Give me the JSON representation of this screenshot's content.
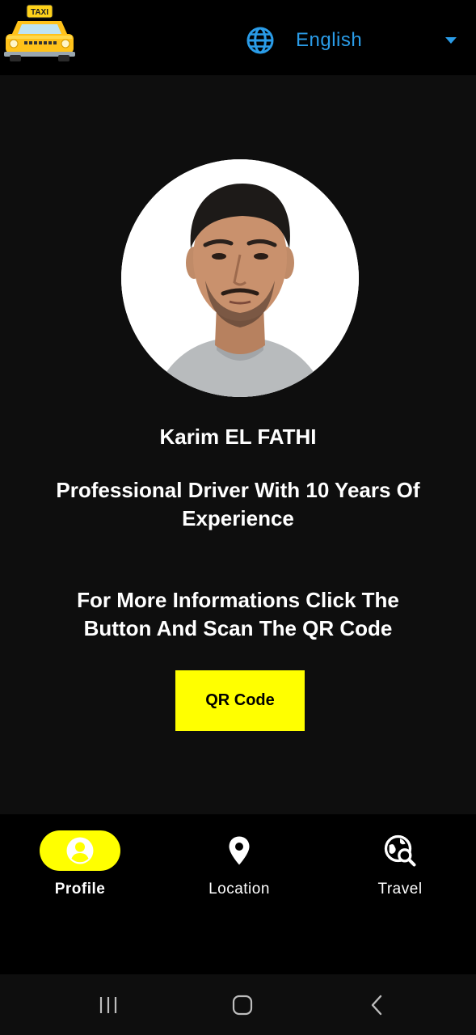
{
  "header": {
    "logo_text": "TAXI",
    "language": "English"
  },
  "profile": {
    "name": "Karim EL FATHI",
    "subtitle": "Professional Driver With 10 Years Of Experience",
    "info": "For More Informations Click The Button And Scan The QR Code",
    "qr_button_label": "QR Code"
  },
  "nav": {
    "items": [
      {
        "label": "Profile",
        "icon": "person-icon",
        "active": true
      },
      {
        "label": "Location",
        "icon": "location-pin-icon",
        "active": false
      },
      {
        "label": "Travel",
        "icon": "travel-explore-icon",
        "active": false
      }
    ]
  },
  "colors": {
    "accent": "#ffff00",
    "language_text": "#2a9ce8",
    "background": "#0e0e0e",
    "bar": "#000000"
  },
  "system_nav": {
    "buttons": [
      "recent-apps-icon",
      "home-icon",
      "back-icon"
    ]
  }
}
